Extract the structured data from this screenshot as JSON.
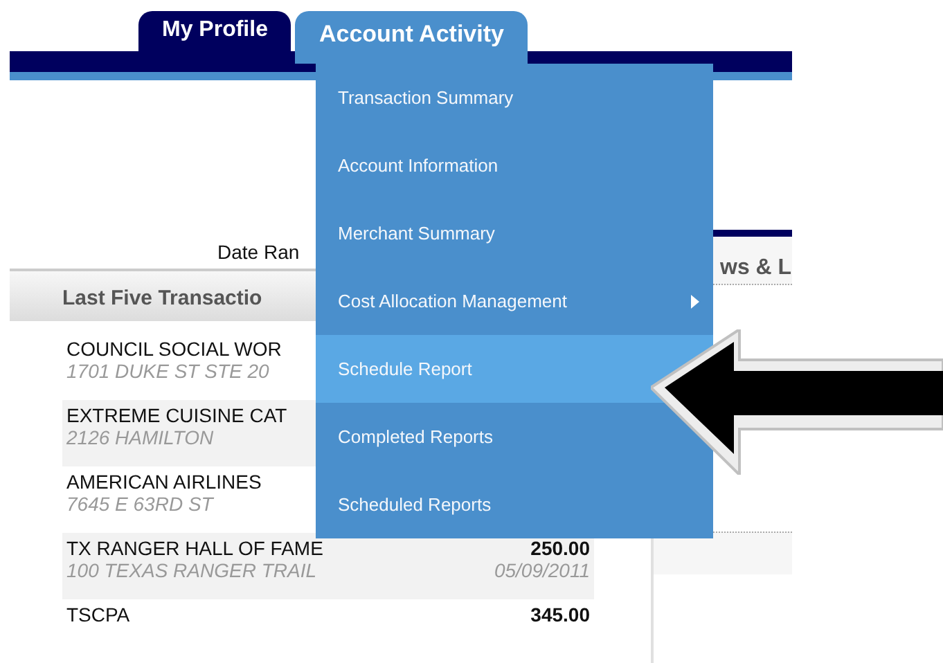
{
  "tabs": [
    {
      "label": "My Profile",
      "selected": false
    },
    {
      "label": "Account Activity",
      "selected": true
    }
  ],
  "menu": {
    "items": [
      {
        "label": "Transaction Summary",
        "selected": false,
        "submenu": false
      },
      {
        "label": "Account Information",
        "selected": false,
        "submenu": false
      },
      {
        "label": "Merchant Summary",
        "selected": false,
        "submenu": false
      },
      {
        "label": "Cost Allocation Management",
        "selected": false,
        "submenu": true
      },
      {
        "label": "Schedule Report",
        "selected": true,
        "submenu": false
      },
      {
        "label": "Completed Reports",
        "selected": false,
        "submenu": false
      },
      {
        "label": "Scheduled Reports",
        "selected": false,
        "submenu": false
      }
    ]
  },
  "date_range_label": "Date Ran",
  "transactions": {
    "title": "Last Five Transactio",
    "rows": [
      {
        "merchant": "COUNCIL SOCIAL WOR",
        "address": "1701 DUKE ST STE 20"
      },
      {
        "merchant": "EXTREME CUISINE CAT",
        "address": "2126 HAMILTON"
      },
      {
        "merchant": "AMERICAN AIRLINES",
        "address": "7645 E 63RD ST"
      },
      {
        "merchant": "TX RANGER HALL OF FAME",
        "address": "100 TEXAS RANGER TRAIL",
        "amount": "250.00",
        "date": "05/09/2011"
      },
      {
        "merchant": "TSCPA",
        "amount": "345.00"
      }
    ]
  },
  "news": {
    "title": "ws & L"
  }
}
